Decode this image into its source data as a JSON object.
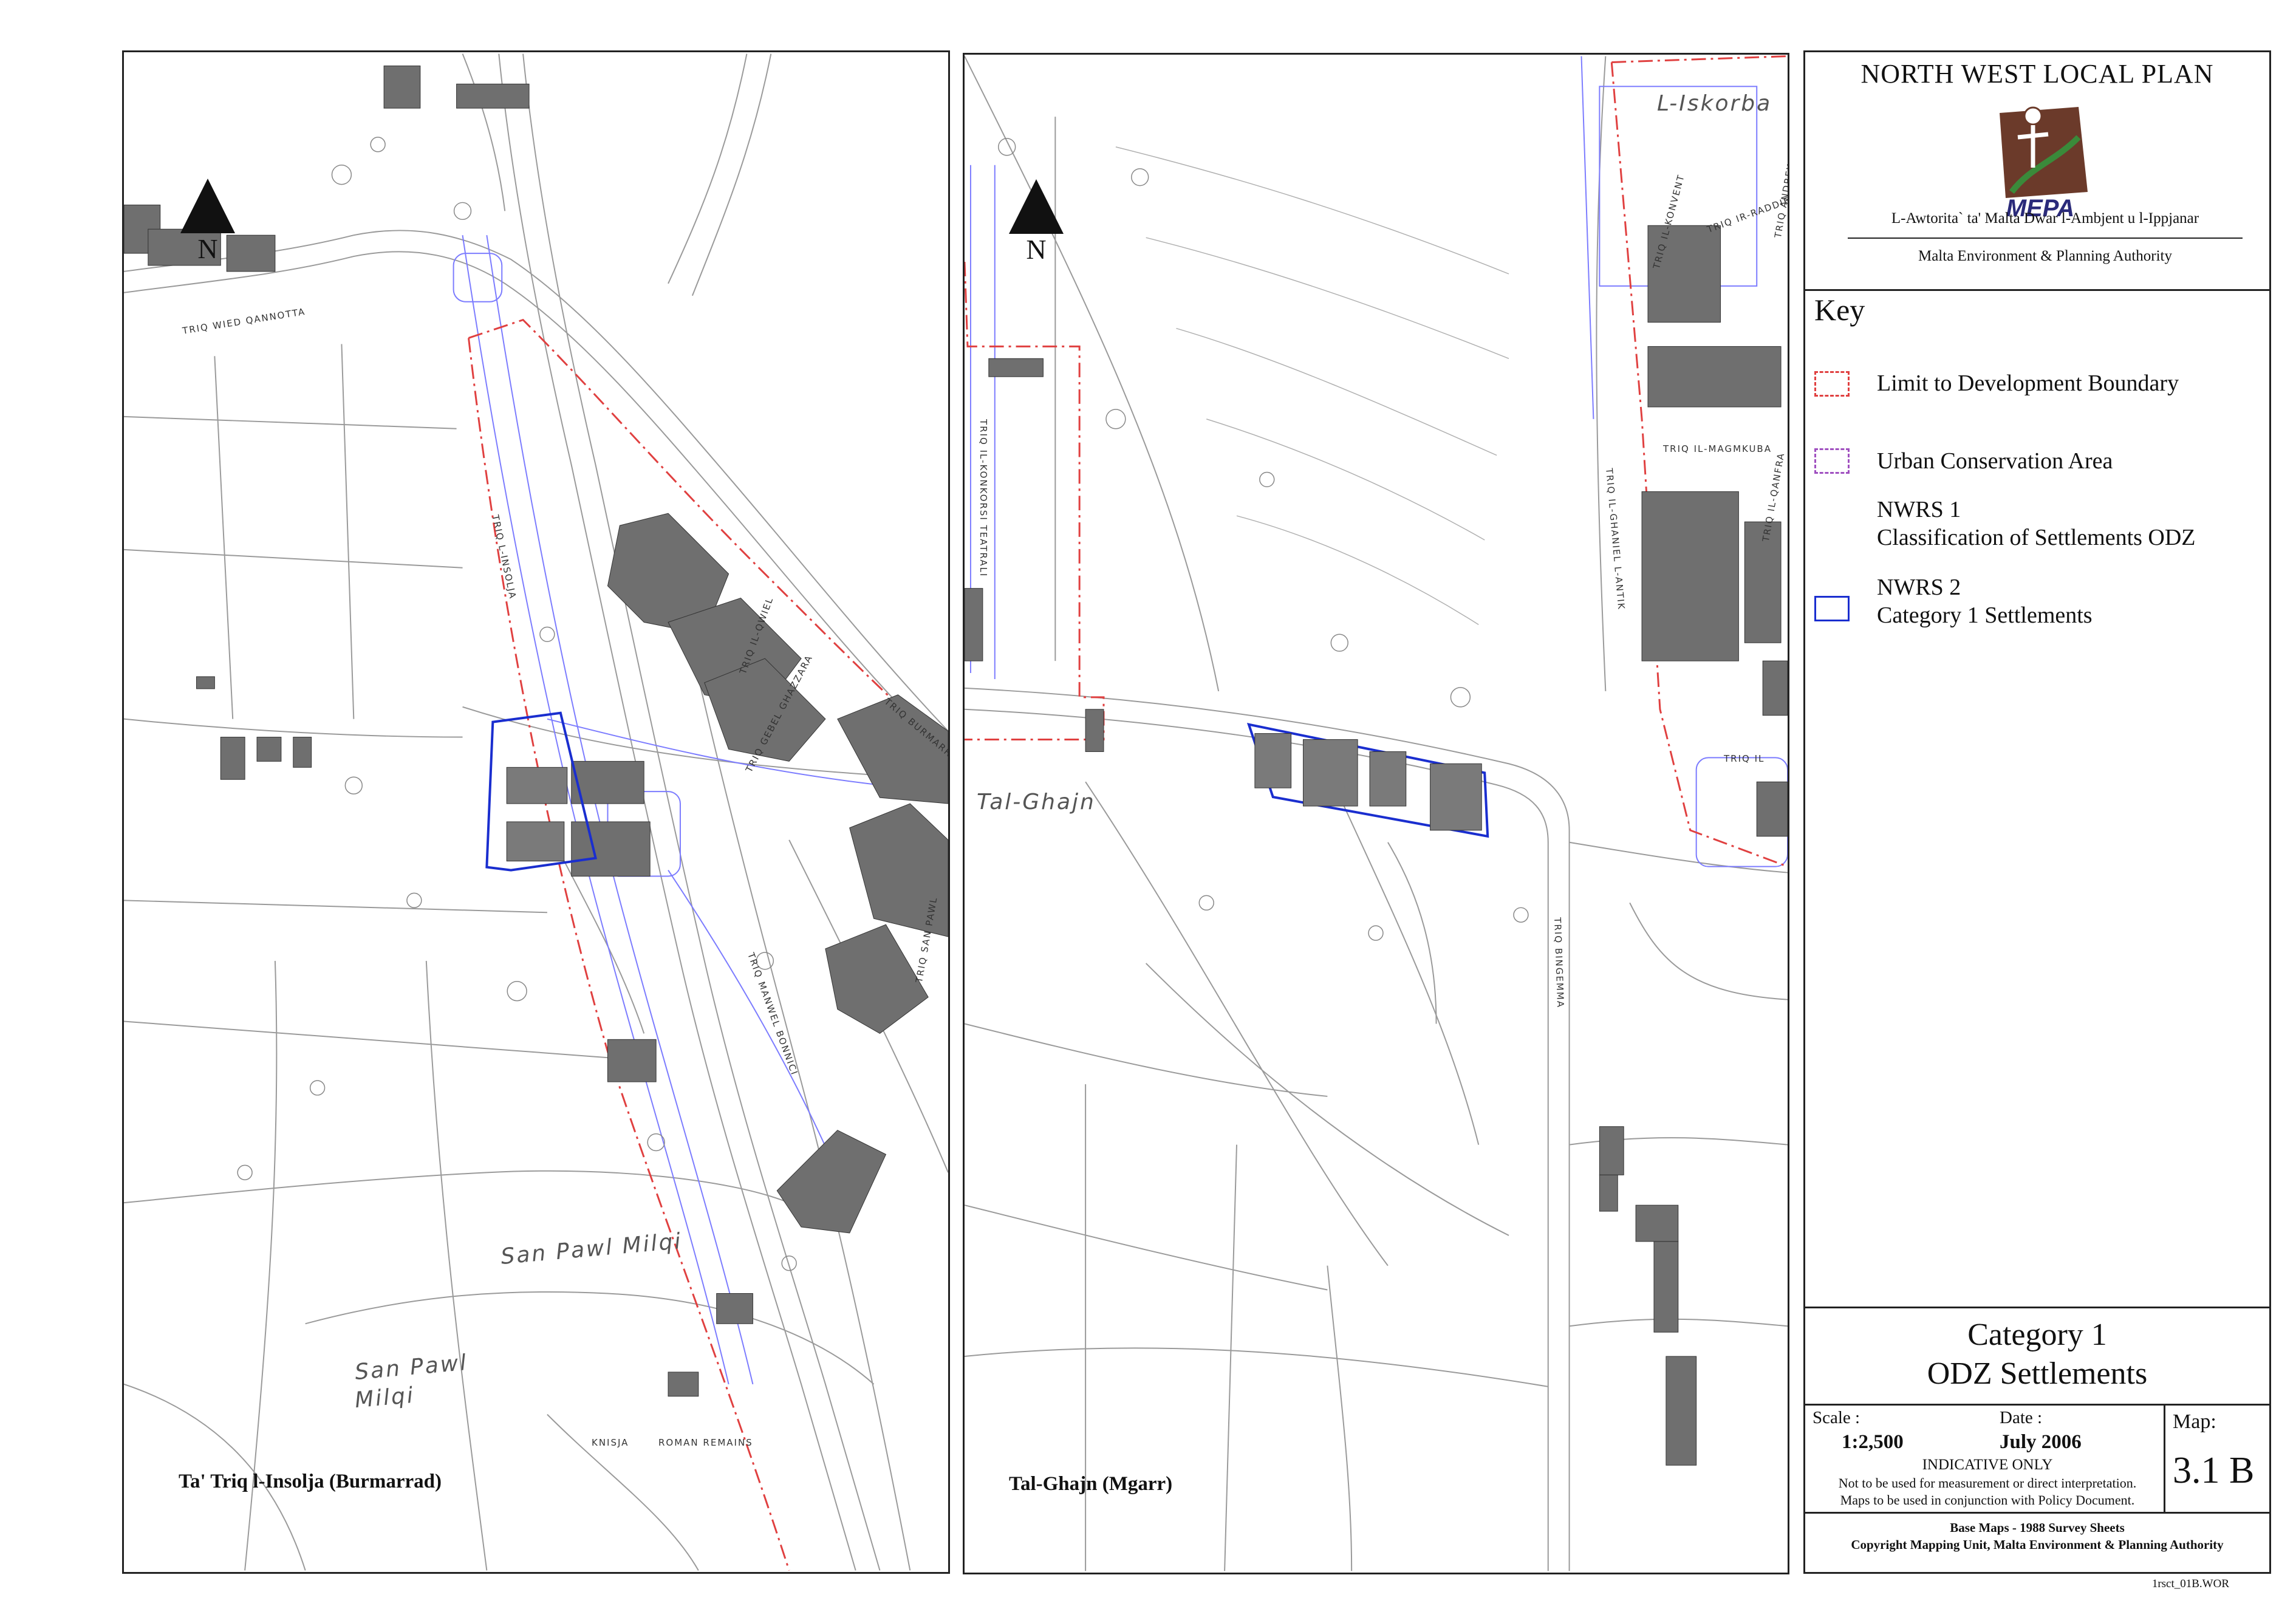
{
  "maps": [
    {
      "caption": "Ta' Triq l-Insolja (Burmarrad)",
      "north_label": "N",
      "places": [
        "San Pawl Milqi",
        "San Pawl",
        "Milqi"
      ],
      "streets": [
        "TRIQ WIED QANNOTTA",
        "TRIQ L-INSOLJA",
        "TRIQ IL-QWIEL",
        "TRIQ GEBEL GHAZZARA",
        "TRIQ BURMARRAD",
        "TRIQ MANWEL BONNICI",
        "TRIQ SAN PAWL",
        "KNISJA",
        "ROMAN REMAINS"
      ]
    },
    {
      "caption": "Tal-Ghajn (Mgarr)",
      "north_label": "N",
      "places": [
        "L-Iskorba",
        "Tal-Ghajn"
      ],
      "streets": [
        "TRIQ IL-KONVENT",
        "TRIQ IL-KONKORSI TEATRALI",
        "TRIQ IL-MAGMKUBA",
        "TRIQ IL-QANFRA",
        "TRIQ IL-GHANIEL L-ANTIK",
        "TRIQ IR-RADDIENA",
        "TRIQ ANDREW",
        "TRIQ IL",
        "TRIQ BINGEMMA"
      ]
    }
  ],
  "legend": {
    "title": "NORTH WEST LOCAL PLAN",
    "logo_text": "MEPA",
    "authority_mt": "L-Awtorita` ta' Malta Dwar l-Ambjent u l-Ippjanar",
    "authority_en": "Malta Environment & Planning Authority",
    "key_heading": "Key",
    "key_items": [
      {
        "label": "Limit to Development Boundary",
        "color": "#e04040",
        "style": "dashed"
      },
      {
        "label": "Urban Conservation Area",
        "color": "#a050c0",
        "style": "dashed"
      },
      {
        "label": "NWRS 1",
        "label2": "Classification of Settlements ODZ"
      },
      {
        "label": "NWRS 2",
        "label2": "Category 1 Settlements",
        "color": "#1a2ecf",
        "style": "solid"
      }
    ],
    "map_title_line1": "Category 1",
    "map_title_line2": "ODZ Settlements",
    "scale_label": "Scale :",
    "scale_value": "1:2,500",
    "date_label": "Date :",
    "date_value": "July 2006",
    "indicative": "INDICATIVE ONLY",
    "disclaimer1": "Not to be used for measurement or direct interpretation.",
    "disclaimer2": "Maps to be used in conjunction with Policy Document.",
    "map_label": "Map:",
    "map_number": "3.1 B",
    "base_maps": "Base Maps - 1988 Survey Sheets",
    "copyright": "Copyright Mapping Unit, Malta Environment & Planning Authority",
    "file_code": "1rsct_01B.WOR"
  }
}
